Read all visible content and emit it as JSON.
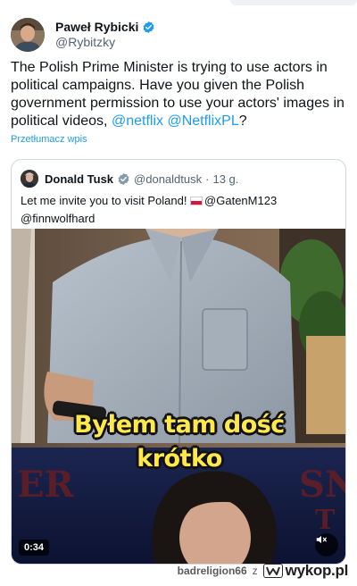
{
  "tweet": {
    "author_name": "Paweł Rybicki",
    "author_handle": "@Rybitzky",
    "text_parts": [
      "The Polish Prime Minister is trying to use actors in political campaigns. Have you given the Polish government permission to use your actors' images in political videos, ",
      "@netflix",
      " ",
      "@NetflixPL",
      "?"
    ],
    "translate_label": "Przetłumacz wpis"
  },
  "quote": {
    "author_name": "Donald Tusk",
    "author_handle": "@donaldtusk",
    "separator": "·",
    "time": "13 g.",
    "text_before_flag": "Let me invite you to visit Poland! ",
    "text_after_flag": "@GatenM123",
    "text_line2": "@finnwolfhard",
    "video": {
      "caption_line1": "Byłem tam dość",
      "caption_line2": "krótko",
      "duration": "0:34",
      "mute_icon": "volume-muted-icon"
    }
  },
  "watermark": {
    "username": "badreligion66",
    "connector": "z",
    "brand": "wykop.pl"
  },
  "colors": {
    "link": "#1d9bf0",
    "text": "#0f1419",
    "secondary": "#536471",
    "caption": "#ffe94a",
    "border": "#cfd9de"
  }
}
